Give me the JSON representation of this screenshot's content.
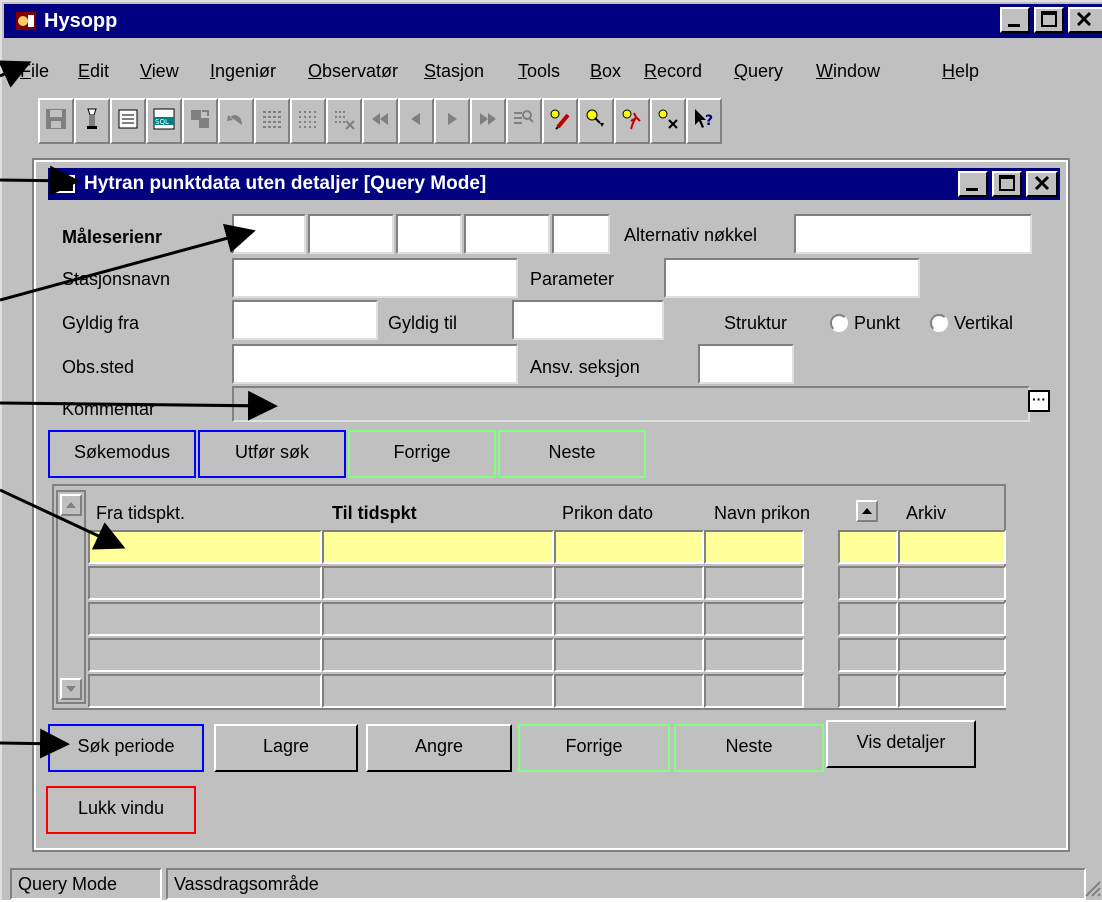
{
  "app": {
    "title": "Hysopp"
  },
  "menu": [
    "File",
    "Edit",
    "View",
    "Ingeniør",
    "Observatør",
    "Stasjon",
    "Tools",
    "Box",
    "Record",
    "Query",
    "Window",
    "Help"
  ],
  "form": {
    "title": "Hytran punktdata uten detaljer [Query Mode]",
    "labels": {
      "maleserienr": "Måleserienr",
      "alternativ": "Alternativ nøkkel",
      "stasjonsnavn": "Stasjonsnavn",
      "parameter": "Parameter",
      "gyldig_fra": "Gyldig fra",
      "gyldig_til": "Gyldig til",
      "struktur": "Struktur",
      "punkt": "Punkt",
      "vertikal": "Vertikal",
      "obs_sted": "Obs.sted",
      "ansv_seksjon": "Ansv. seksjon",
      "kommentar": "Kommentar"
    },
    "kommentar_button": "···",
    "query_buttons": {
      "sokemodus": "Søkemodus",
      "utfor_sok": "Utfør søk",
      "forrige": "Forrige",
      "neste": "Neste"
    },
    "grid": {
      "columns": {
        "fra": "Fra tidspkt.",
        "til": "Til tidspkt",
        "prikon_dato": "Prikon dato",
        "navn_prikon": "Navn prikon",
        "arkiv": "Arkiv"
      }
    },
    "bottom_buttons": {
      "sok_periode": "Søk periode",
      "lagre": "Lagre",
      "angre": "Angre",
      "forrige": "Forrige",
      "neste": "Neste",
      "vis_detaljer": "Vis detaljer"
    },
    "close_button": "Lukk vindu"
  },
  "status": {
    "mode": "Query Mode",
    "area": "Vassdragsområde"
  }
}
